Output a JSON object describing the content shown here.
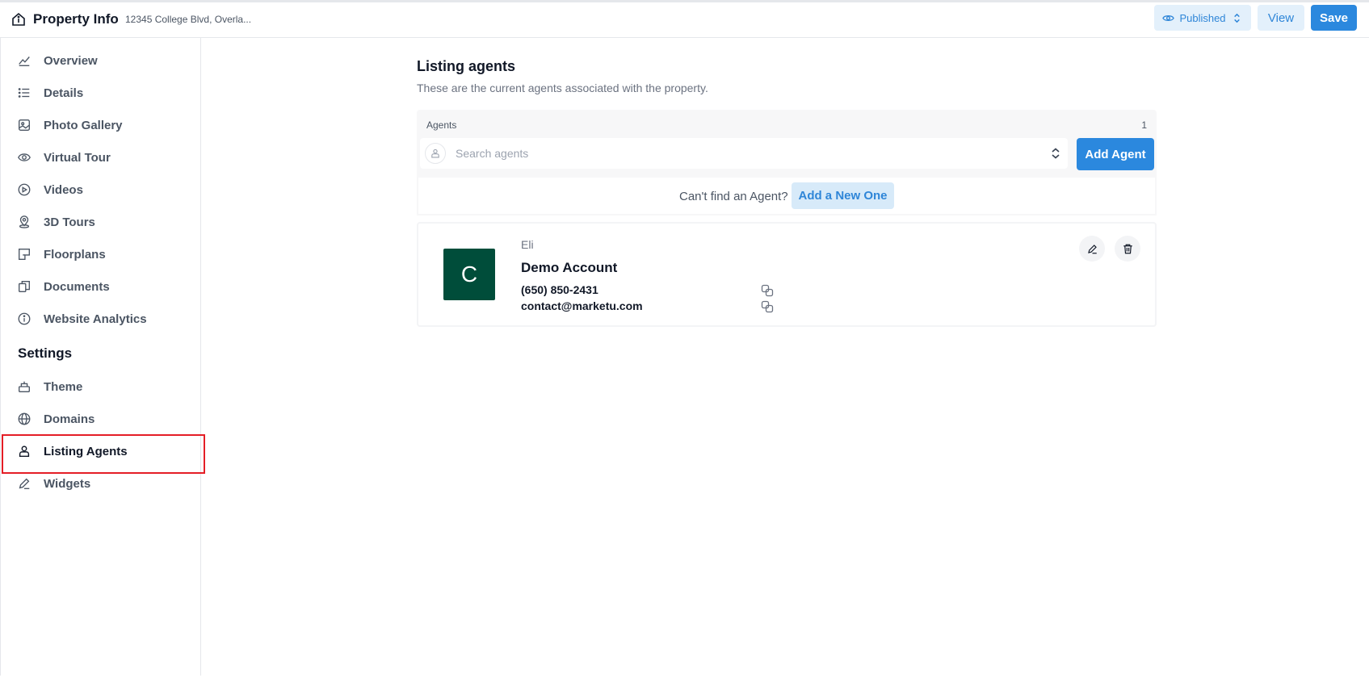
{
  "header": {
    "title": "Property Info",
    "address": "12345 College Blvd, Overla...",
    "status_label": "Published",
    "view_label": "View",
    "save_label": "Save",
    "accent_color": "#2b88de"
  },
  "sidebar": {
    "items": [
      {
        "label": "Overview",
        "icon": "chart-line-icon"
      },
      {
        "label": "Details",
        "icon": "list-icon"
      },
      {
        "label": "Photo Gallery",
        "icon": "image-icon"
      },
      {
        "label": "Virtual Tour",
        "icon": "eye-icon"
      },
      {
        "label": "Videos",
        "icon": "play-circle-icon"
      },
      {
        "label": "3D Tours",
        "icon": "location-pin-icon"
      },
      {
        "label": "Floorplans",
        "icon": "floorplan-icon"
      },
      {
        "label": "Documents",
        "icon": "documents-icon"
      },
      {
        "label": "Website Analytics",
        "icon": "info-icon"
      }
    ],
    "settings_heading": "Settings",
    "settings_items": [
      {
        "label": "Theme",
        "icon": "paint-bucket-icon"
      },
      {
        "label": "Domains",
        "icon": "globe-icon"
      },
      {
        "label": "Listing Agents",
        "icon": "user-icon",
        "active": true
      },
      {
        "label": "Widgets",
        "icon": "pencil-icon"
      }
    ]
  },
  "main": {
    "heading": "Listing agents",
    "subheading": "These are the current agents associated with the property.",
    "agents_label": "Agents",
    "agents_count": "1",
    "search_placeholder": "Search agents",
    "add_agent_label": "Add Agent",
    "cant_find_text": "Can't find an Agent?",
    "add_new_label": "Add a New One"
  },
  "agent": {
    "avatar_letter": "C",
    "avatar_color": "#004d3a",
    "first_name": "Eli",
    "full_name": "Demo Account",
    "phone": "(650) 850-2431",
    "email": "contact@marketu.com"
  }
}
